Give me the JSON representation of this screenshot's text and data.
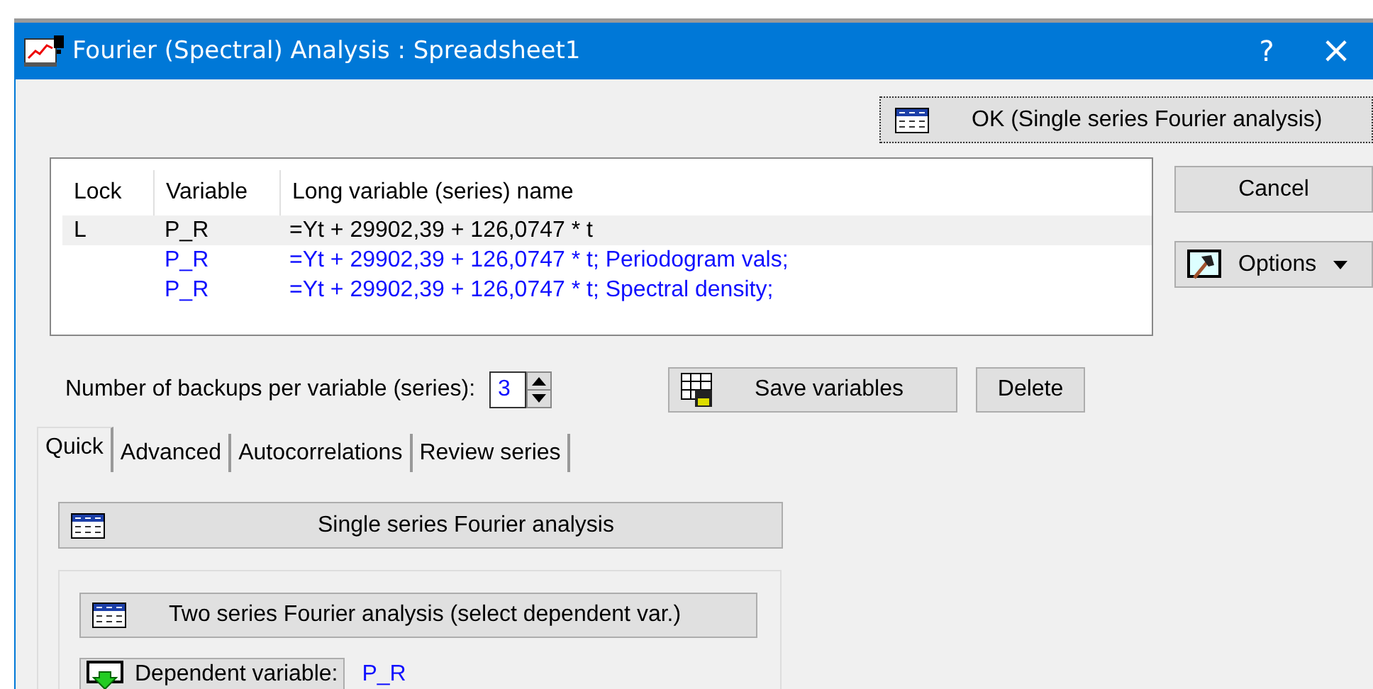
{
  "window": {
    "title": "Fourier (Spectral) Analysis : Spreadsheet1",
    "help": "?",
    "close": "×"
  },
  "ok_button": "OK (Single series Fourier analysis)",
  "table": {
    "columns": [
      "Lock",
      "Variable",
      "Long variable (series) name"
    ],
    "rows": [
      {
        "lock": "L",
        "variable": "P_R",
        "name": "=Yt + 29902,39 + 126,0747 * t",
        "selected": true,
        "kind": "source"
      },
      {
        "variable": "P_R",
        "name": "=Yt + 29902,39 + 126,0747 * t; Periodogram vals;",
        "selected": false,
        "kind": "result"
      },
      {
        "variable": "P_R",
        "name": "=Yt + 29902,39 + 126,0747 * t; Spectral density;",
        "selected": false,
        "kind": "result"
      }
    ]
  },
  "cancel_button": "Cancel",
  "options_button": "Options",
  "backups": {
    "label": "Number of backups per variable (series):",
    "value": "3"
  },
  "save_button": "Save variables",
  "delete_button": "Delete",
  "tabs": [
    {
      "label": "Quick",
      "selected": true
    },
    {
      "label": "Advanced",
      "selected": false
    },
    {
      "label": "Autocorrelations",
      "selected": false
    },
    {
      "label": "Review series",
      "selected": false
    }
  ],
  "single_button": "Single series Fourier analysis",
  "two_button": "Two series Fourier analysis (select dependent var.)",
  "dependent": {
    "button": "Dependent variable:",
    "value": "P_R"
  }
}
